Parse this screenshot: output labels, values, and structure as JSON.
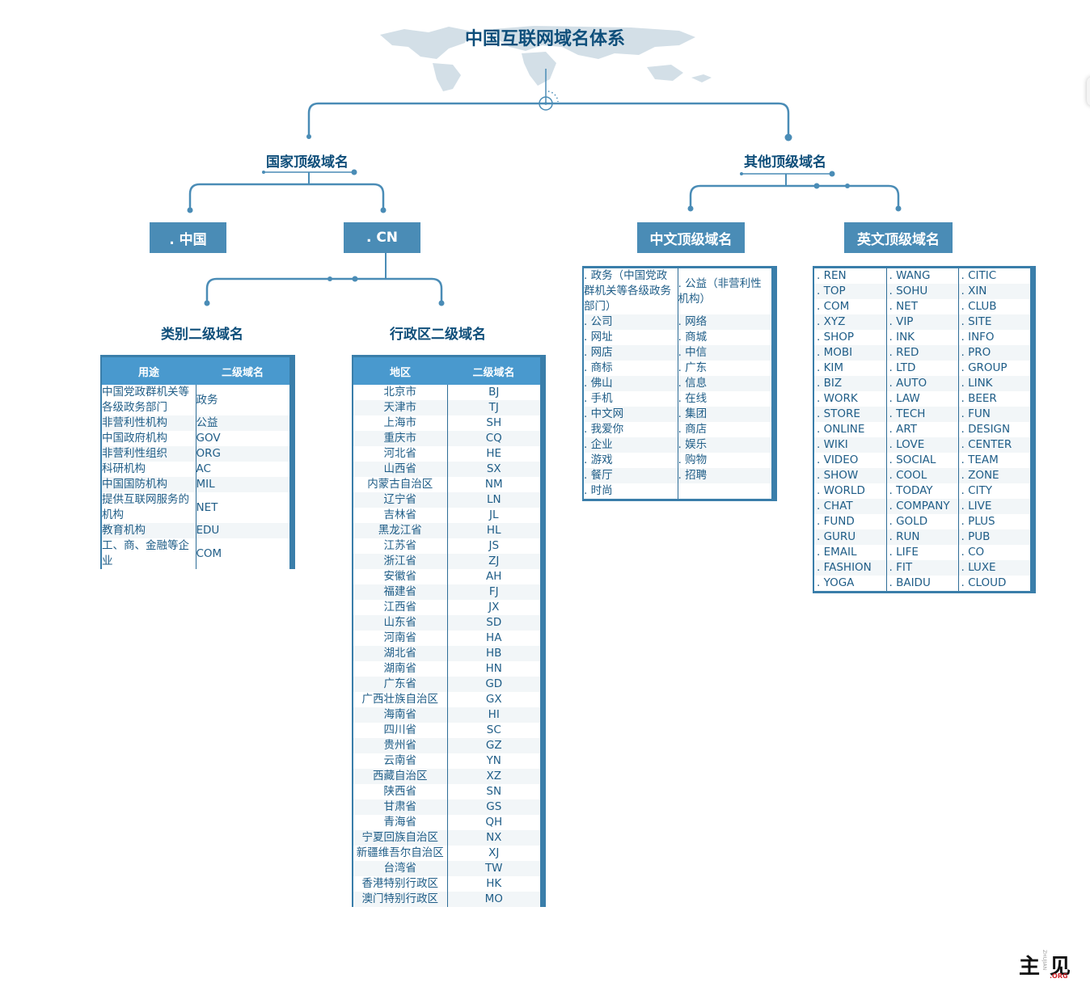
{
  "title": "中国互联网域名体系",
  "branches": {
    "national": "国家顶级域名",
    "other": "其他顶级域名"
  },
  "boxes": {
    "zhongguo": ". 中国",
    "cn": ". CN",
    "chinese_tld": "中文顶级域名",
    "english_tld": "英文顶级域名"
  },
  "sub_labels": {
    "category": "类别二级域名",
    "region": "行政区二级域名"
  },
  "category_table": {
    "headers": [
      "用途",
      "二级域名"
    ],
    "rows": [
      [
        "中国党政群机关等各级政务部门",
        "政务"
      ],
      [
        "非营利性机构",
        "公益"
      ],
      [
        "中国政府机构",
        "GOV"
      ],
      [
        "非营利性组织",
        "ORG"
      ],
      [
        "科研机构",
        "AC"
      ],
      [
        "中国国防机构",
        "MIL"
      ],
      [
        "提供互联网服务的机构",
        "NET"
      ],
      [
        "教育机构",
        "EDU"
      ],
      [
        "工、商、金融等企业",
        "COM"
      ]
    ]
  },
  "region_table": {
    "headers": [
      "地区",
      "二级域名"
    ],
    "rows": [
      [
        "北京市",
        "BJ"
      ],
      [
        "天津市",
        "TJ"
      ],
      [
        "上海市",
        "SH"
      ],
      [
        "重庆市",
        "CQ"
      ],
      [
        "河北省",
        "HE"
      ],
      [
        "山西省",
        "SX"
      ],
      [
        "内蒙古自治区",
        "NM"
      ],
      [
        "辽宁省",
        "LN"
      ],
      [
        "吉林省",
        "JL"
      ],
      [
        "黑龙江省",
        "HL"
      ],
      [
        "江苏省",
        "JS"
      ],
      [
        "浙江省",
        "ZJ"
      ],
      [
        "安徽省",
        "AH"
      ],
      [
        "福建省",
        "FJ"
      ],
      [
        "江西省",
        "JX"
      ],
      [
        "山东省",
        "SD"
      ],
      [
        "河南省",
        "HA"
      ],
      [
        "湖北省",
        "HB"
      ],
      [
        "湖南省",
        "HN"
      ],
      [
        "广东省",
        "GD"
      ],
      [
        "广西壮族自治区",
        "GX"
      ],
      [
        "海南省",
        "HI"
      ],
      [
        "四川省",
        "SC"
      ],
      [
        "贵州省",
        "GZ"
      ],
      [
        "云南省",
        "YN"
      ],
      [
        "西藏自治区",
        "XZ"
      ],
      [
        "陕西省",
        "SN"
      ],
      [
        "甘肃省",
        "GS"
      ],
      [
        "青海省",
        "QH"
      ],
      [
        "宁夏回族自治区",
        "NX"
      ],
      [
        "新疆维吾尔自治区",
        "XJ"
      ],
      [
        "台湾省",
        "TW"
      ],
      [
        "香港特别行政区",
        "HK"
      ],
      [
        "澳门特别行政区",
        "MO"
      ]
    ]
  },
  "chinese_tld_table": {
    "rows": [
      [
        ". 政务（中国党政群机关等各级政务部门）",
        ". 公益（非营利性机构）"
      ],
      [
        ". 公司",
        ". 网络"
      ],
      [
        ". 网址",
        ". 商城"
      ],
      [
        ". 网店",
        ". 中信"
      ],
      [
        ". 商标",
        ". 广东"
      ],
      [
        ". 佛山",
        ". 信息"
      ],
      [
        ". 手机",
        ". 在线"
      ],
      [
        ". 中文网",
        ". 集团"
      ],
      [
        ". 我爱你",
        ". 商店"
      ],
      [
        ". 企业",
        ". 娱乐"
      ],
      [
        ". 游戏",
        ". 购物"
      ],
      [
        ". 餐厅",
        ". 招聘"
      ],
      [
        ". 时尚",
        ""
      ]
    ]
  },
  "english_tld_table": {
    "rows": [
      [
        ". REN",
        ". WANG",
        ". CITIC"
      ],
      [
        ". TOP",
        ". SOHU",
        ". XIN"
      ],
      [
        ". COM",
        ". NET",
        ". CLUB"
      ],
      [
        ". XYZ",
        ". VIP",
        ". SITE"
      ],
      [
        ". SHOP",
        ". INK",
        ". INFO"
      ],
      [
        ". MOBI",
        ". RED",
        ". PRO"
      ],
      [
        ". KIM",
        ". LTD",
        ". GROUP"
      ],
      [
        ". BIZ",
        ". AUTO",
        ". LINK"
      ],
      [
        ". WORK",
        ". LAW",
        ". BEER"
      ],
      [
        ". STORE",
        ". TECH",
        ". FUN"
      ],
      [
        ". ONLINE",
        ". ART",
        ". DESIGN"
      ],
      [
        ". WIKI",
        ". LOVE",
        ". CENTER"
      ],
      [
        ". VIDEO",
        ". SOCIAL",
        ". TEAM"
      ],
      [
        ". SHOW",
        ". COOL",
        ". ZONE"
      ],
      [
        ". WORLD",
        ". TODAY",
        ". CITY"
      ],
      [
        ". CHAT",
        ". COMPANY",
        ". LIVE"
      ],
      [
        ". FUND",
        ". GOLD",
        ". PLUS"
      ],
      [
        ". GURU",
        ". RUN",
        ". PUB"
      ],
      [
        ". EMAIL",
        ". LIFE",
        ". CO"
      ],
      [
        ". FASHION",
        ". FIT",
        ". LUXE"
      ],
      [
        ". YOGA",
        ". BAIDU",
        ". CLOUD"
      ]
    ]
  },
  "watermark": {
    "main": "主见",
    "vertical": "ZHUJIAN",
    "suffix": ".ORG"
  },
  "colors": {
    "line": "#4a8cb6",
    "box": "#4a8cb6",
    "header": "#4999ce",
    "title": "#0e4e7a",
    "map": "#d3dfe7"
  }
}
